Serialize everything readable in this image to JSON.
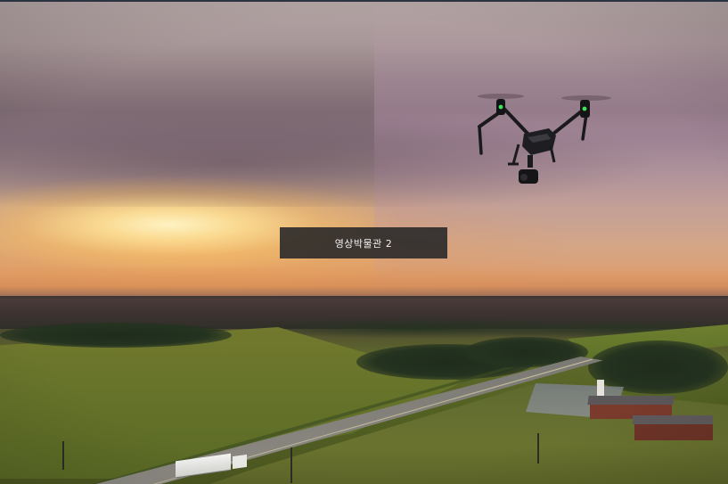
{
  "caption": {
    "text": "영상박물관 2"
  },
  "scene": {
    "subjects": [
      "drone",
      "truck",
      "church"
    ]
  }
}
